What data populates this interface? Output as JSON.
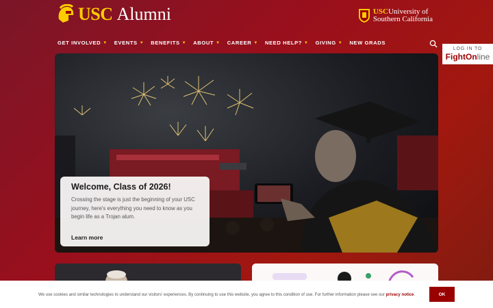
{
  "header": {
    "logo_usc": "USC",
    "logo_alumni": "Alumni",
    "univ_line1_usc": "USC",
    "univ_line1_rest": "University of",
    "univ_line2": "Southern California"
  },
  "nav": {
    "items": [
      {
        "label": "GET INVOLVED",
        "caret": "▼"
      },
      {
        "label": "EVENTS",
        "caret": "▼"
      },
      {
        "label": "BENEFITS",
        "caret": "▼"
      },
      {
        "label": "ABOUT",
        "caret": "▼"
      },
      {
        "label": "CAREER",
        "caret": "▼"
      },
      {
        "label": "NEED HELP?",
        "caret": "▼"
      },
      {
        "label": "GIVING",
        "caret": "▼"
      },
      {
        "label": "NEW GRADS",
        "caret": ""
      }
    ]
  },
  "login": {
    "line1": "LOG IN TO",
    "fight": "Fight",
    "on": "On",
    "line": "line"
  },
  "hero": {
    "title": "Welcome, Class of 2026!",
    "body": "Crossing the stage is just the beginning of your USC journey, here's everything you need to know as you begin life as a Trojan alum.",
    "cta": "Learn more"
  },
  "cookie": {
    "text": "We use cookies and similar technologies to understand our visitors' experiences. By continuing to use this website, you agree to this condition of use. For further information please see our ",
    "link": "privacy notice",
    "after": ".",
    "ok": "OK"
  },
  "colors": {
    "cardinal": "#990000",
    "gold": "#ffcc00"
  }
}
